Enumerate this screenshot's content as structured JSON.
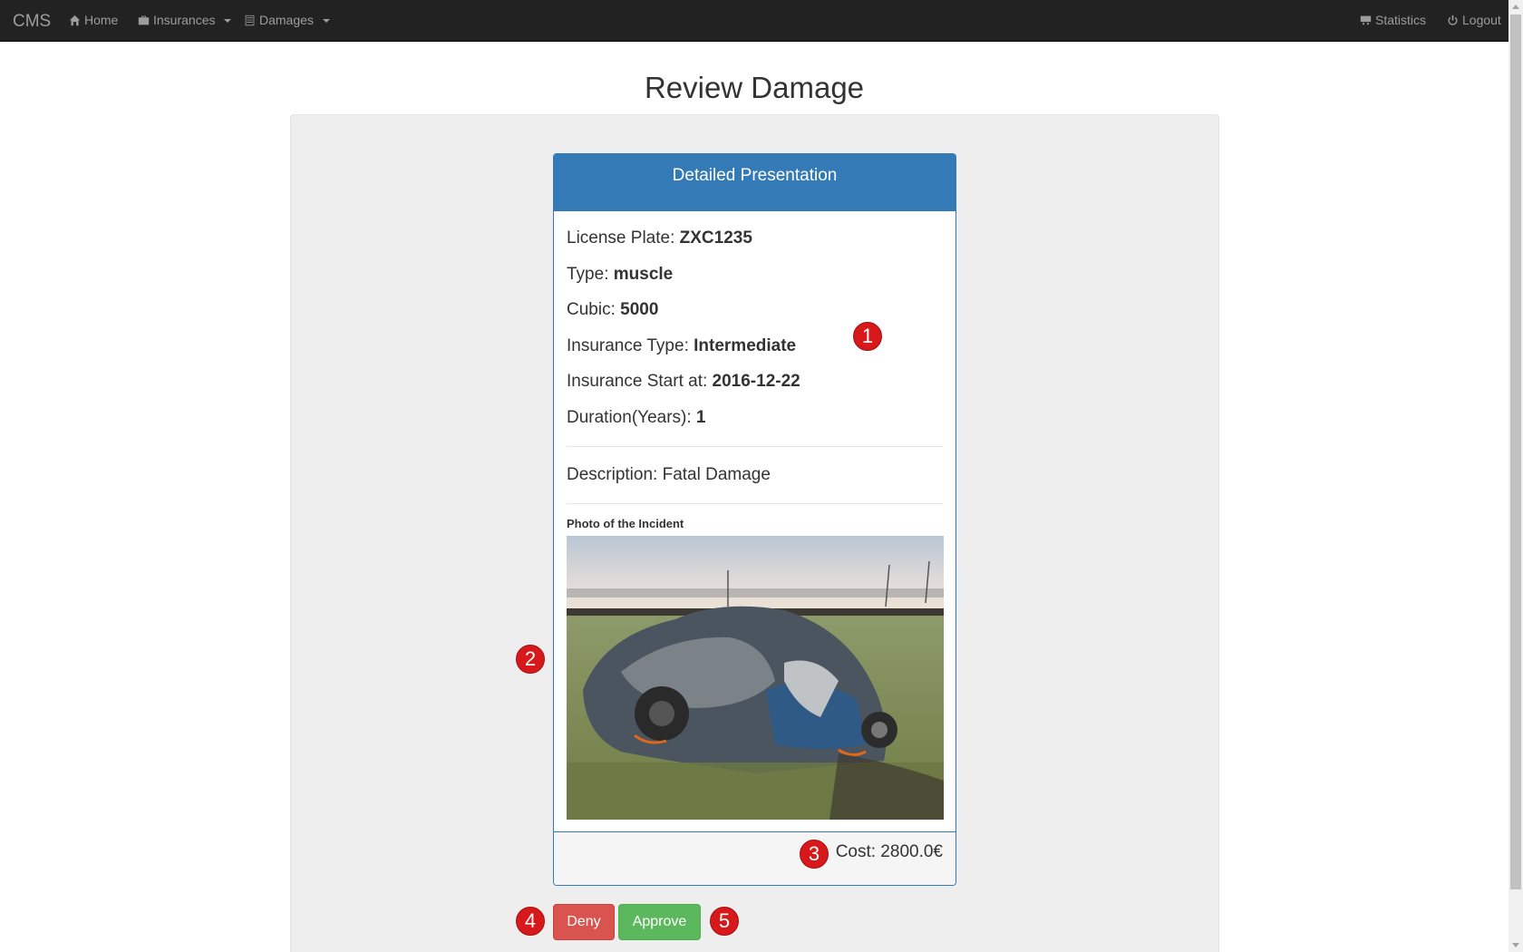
{
  "navbar": {
    "brand": "CMS",
    "home": "Home",
    "insurances": "Insurances",
    "damages": "Damages",
    "statistics": "Statistics",
    "logout": "Logout"
  },
  "page": {
    "title": "Review Damage"
  },
  "panel": {
    "heading": "Detailed Presentation",
    "fields": [
      {
        "label": "License Plate: ",
        "value": "ZXC1235"
      },
      {
        "label": "Type: ",
        "value": "muscle"
      },
      {
        "label": "Cubic: ",
        "value": "5000"
      },
      {
        "label": "Insurance Type: ",
        "value": "Intermediate"
      },
      {
        "label": "Insurance Start at: ",
        "value": "2016-12-22"
      },
      {
        "label": "Duration(Years): ",
        "value": "1"
      }
    ],
    "description": "Description: Fatal Damage",
    "photo_label": "Photo of the Incident",
    "cost": "Cost: 2800.0€"
  },
  "actions": {
    "deny": "Deny",
    "approve": "Approve"
  },
  "markers": [
    "1",
    "2",
    "3",
    "4",
    "5"
  ],
  "colors": {
    "navbar": "#222222",
    "primary": "#337ab7",
    "deny": "#d9534f",
    "approve": "#5cb85c",
    "marker": "#d7191c"
  }
}
